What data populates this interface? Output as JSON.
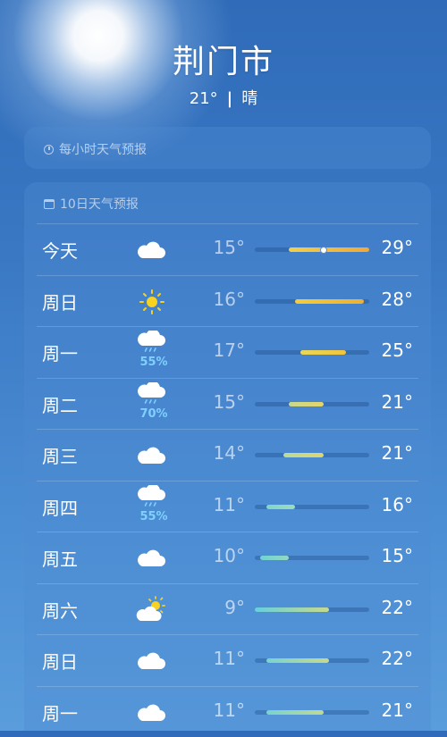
{
  "header": {
    "city": "荆门市",
    "temp": "21°",
    "divider": "|",
    "condition": "晴"
  },
  "hourly": {
    "title": "每小时天气预报",
    "icon": "clock-icon"
  },
  "daily": {
    "title": "10日天气预报",
    "icon": "calendar-icon",
    "scale_min": 9,
    "scale_max": 29,
    "days": [
      {
        "day": "今天",
        "icon": "cloud-icon",
        "pop": "",
        "low": "15°",
        "high": "29°",
        "lo": 15,
        "hi": 29,
        "current": 21,
        "color": "linear-gradient(90deg,#f1d04a,#f0a83a)"
      },
      {
        "day": "周日",
        "icon": "sun-icon",
        "pop": "",
        "low": "16°",
        "high": "28°",
        "lo": 16,
        "hi": 28,
        "color": "linear-gradient(90deg,#f4cc3a,#efaf33)"
      },
      {
        "day": "周一",
        "icon": "rain-cloud-icon",
        "pop": "55%",
        "low": "17°",
        "high": "25°",
        "lo": 17,
        "hi": 25,
        "color": "linear-gradient(90deg,#e6d85a,#f2c43d)"
      },
      {
        "day": "周二",
        "icon": "rain-cloud-icon",
        "pop": "70%",
        "low": "15°",
        "high": "21°",
        "lo": 15,
        "hi": 21,
        "color": "linear-gradient(90deg,#c8d98a,#e4d56b)"
      },
      {
        "day": "周三",
        "icon": "cloud-icon",
        "pop": "",
        "low": "14°",
        "high": "21°",
        "lo": 14,
        "hi": 21,
        "color": "linear-gradient(90deg,#b9db9a,#ded570)"
      },
      {
        "day": "周四",
        "icon": "rain-cloud-icon",
        "pop": "55%",
        "low": "11°",
        "high": "16°",
        "lo": 11,
        "hi": 16,
        "color": "linear-gradient(90deg,#7fd6c8,#9edbbb)"
      },
      {
        "day": "周五",
        "icon": "cloud-icon",
        "pop": "",
        "low": "10°",
        "high": "15°",
        "lo": 10,
        "hi": 15,
        "color": "linear-gradient(90deg,#6fd3d6,#92d8c2)"
      },
      {
        "day": "周六",
        "icon": "partly-cloudy-icon",
        "pop": "",
        "low": "9°",
        "high": "22°",
        "lo": 9,
        "hi": 22,
        "color": "linear-gradient(90deg,#66cfe0,#c6da8c)"
      },
      {
        "day": "周日",
        "icon": "cloud-icon",
        "pop": "",
        "low": "11°",
        "high": "22°",
        "lo": 11,
        "hi": 22,
        "color": "linear-gradient(90deg,#78d3cf,#c8d98b)"
      },
      {
        "day": "周一",
        "icon": "cloud-icon",
        "pop": "",
        "low": "11°",
        "high": "21°",
        "lo": 11,
        "hi": 21,
        "color": "linear-gradient(90deg,#78d3cf,#c0d993)"
      }
    ]
  }
}
